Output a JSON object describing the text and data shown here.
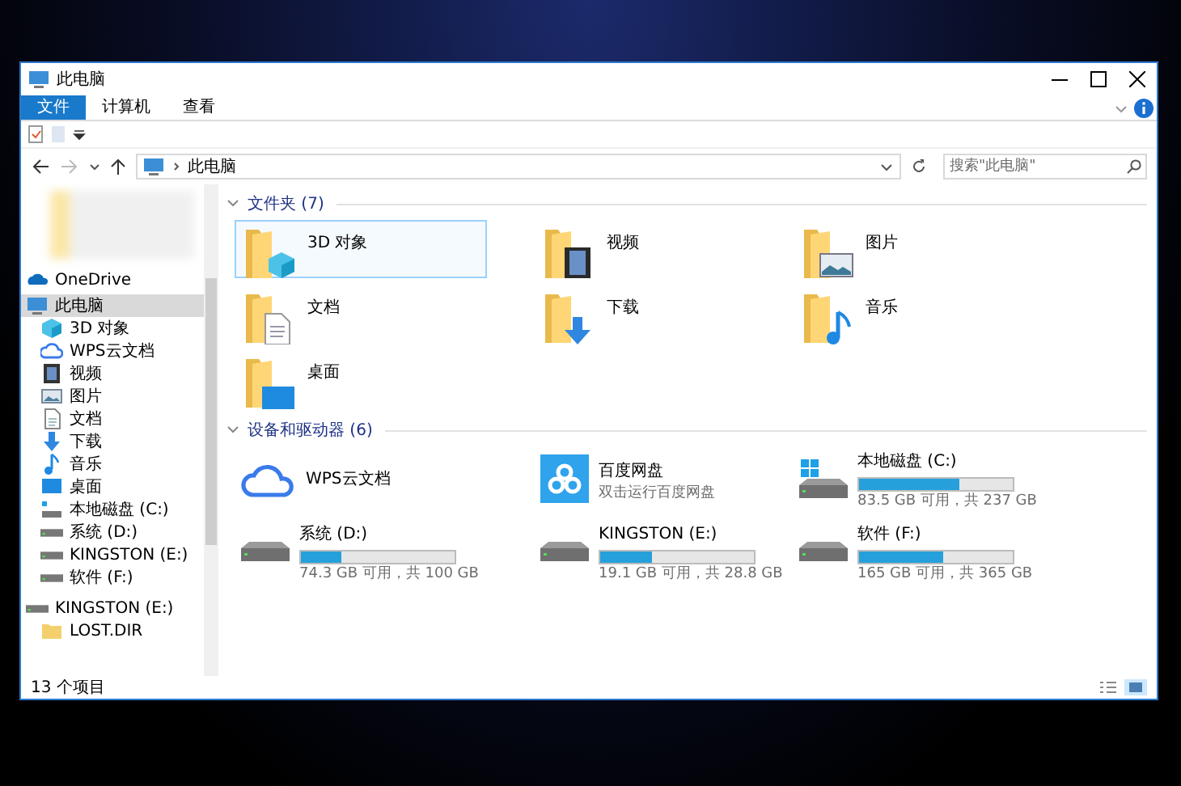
{
  "window": {
    "title": "此电脑"
  },
  "ribbon_tabs": [
    {
      "label": "文件",
      "selected": true
    },
    {
      "label": "计算机",
      "selected": false
    },
    {
      "label": "查看",
      "selected": false
    }
  ],
  "address": {
    "path": "此电脑"
  },
  "search": {
    "placeholder": "搜索\"此电脑\""
  },
  "sidebar": {
    "items": [
      {
        "label": "OneDrive",
        "kind": "onedrive",
        "selected": false
      },
      {
        "label": "此电脑",
        "kind": "pc",
        "selected": true,
        "children": [
          {
            "label": "3D 对象",
            "kind": "cube",
            "selected": false
          },
          {
            "label": "WPS云文档",
            "kind": "cloud",
            "selected": false
          },
          {
            "label": "视频",
            "kind": "film",
            "selected": false
          },
          {
            "label": "图片",
            "kind": "picture",
            "selected": false
          },
          {
            "label": "文档",
            "kind": "document",
            "selected": false
          },
          {
            "label": "下载",
            "kind": "download",
            "selected": false
          },
          {
            "label": "音乐",
            "kind": "music",
            "selected": false
          },
          {
            "label": "桌面",
            "kind": "desktop",
            "selected": false
          },
          {
            "label": "本地磁盘 (C:)",
            "kind": "sysdrive",
            "selected": false
          },
          {
            "label": "系统 (D:)",
            "kind": "drive",
            "selected": false
          },
          {
            "label": "KINGSTON (E:)",
            "kind": "drive",
            "selected": false
          },
          {
            "label": "软件 (F:)",
            "kind": "drive",
            "selected": false
          }
        ]
      },
      {
        "label": "KINGSTON (E:)",
        "kind": "drive",
        "selected": false,
        "children": [
          {
            "label": "LOST.DIR",
            "kind": "folder",
            "selected": false
          }
        ]
      }
    ]
  },
  "sections": [
    {
      "title": "文件夹 (7)",
      "expanded": true,
      "items": [
        {
          "kind": "cube",
          "label": "3D 对象",
          "selected": true
        },
        {
          "kind": "film",
          "label": "视频",
          "selected": false
        },
        {
          "kind": "picture",
          "label": "图片",
          "selected": false
        },
        {
          "kind": "document",
          "label": "文档",
          "selected": false
        },
        {
          "kind": "download",
          "label": "下载",
          "selected": false
        },
        {
          "kind": "music",
          "label": "音乐",
          "selected": false
        },
        {
          "kind": "desktop",
          "label": "桌面",
          "selected": false
        }
      ]
    },
    {
      "title": "设备和驱动器 (6)",
      "expanded": true,
      "items": [
        {
          "kind": "cloud",
          "label": "WPS云文档",
          "selected": false
        },
        {
          "kind": "app",
          "label": "百度网盘",
          "subtitle": "双击运行百度网盘",
          "selected": false
        },
        {
          "kind": "sysdrive",
          "label": "本地磁盘 (C:)",
          "level": 0.65,
          "reading": "83.5 GB 可用，共 237 GB",
          "selected": false
        },
        {
          "kind": "drive",
          "label": "系统 (D:)",
          "level": 0.26,
          "reading": "74.3 GB 可用，共 100 GB",
          "selected": false
        },
        {
          "kind": "drive",
          "label": "KINGSTON (E:)",
          "level": 0.34,
          "reading": "19.1 GB 可用，共 28.8 GB",
          "selected": false
        },
        {
          "kind": "drive",
          "label": "软件 (F:)",
          "level": 0.55,
          "reading": "165 GB 可用，共 365 GB",
          "selected": false
        }
      ]
    }
  ],
  "status_bar": {
    "text": "13 个项目"
  }
}
